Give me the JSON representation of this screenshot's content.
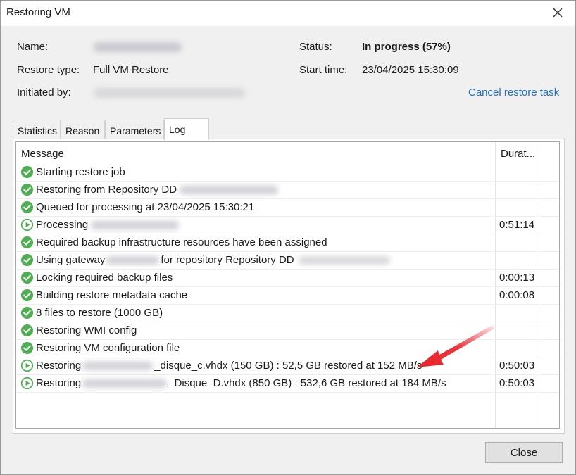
{
  "window": {
    "title": "Restoring VM"
  },
  "summary": {
    "name_label": "Name:",
    "restore_type_label": "Restore type:",
    "restore_type_value": "Full VM Restore",
    "initiated_by_label": "Initiated by:",
    "status_label": "Status:",
    "status_value": "In progress (57%)",
    "start_time_label": "Start time:",
    "start_time_value": "23/04/2025 15:30:09",
    "cancel_link": "Cancel restore task"
  },
  "tabs": [
    {
      "label": "Statistics"
    },
    {
      "label": "Reason"
    },
    {
      "label": "Parameters"
    },
    {
      "label": "Log",
      "active": true
    }
  ],
  "log": {
    "columns": {
      "message": "Message",
      "duration": "Durat..."
    },
    "rows": [
      {
        "status": "success",
        "text": "Starting restore job",
        "duration": ""
      },
      {
        "status": "success",
        "text": "Restoring from Repository DD",
        "duration": ""
      },
      {
        "status": "success",
        "text": "Queued for processing at 23/04/2025 15:30:21",
        "duration": ""
      },
      {
        "status": "running",
        "text": "Processing",
        "duration": "0:51:14"
      },
      {
        "status": "success",
        "text": "Required backup infrastructure resources have been assigned",
        "duration": ""
      },
      {
        "status": "success",
        "text_before": "Using gateway",
        "text_after": "for repository Repository DD",
        "duration": ""
      },
      {
        "status": "success",
        "text": "Locking required backup files",
        "duration": "0:00:13"
      },
      {
        "status": "success",
        "text": "Building restore metadata cache",
        "duration": "0:00:08"
      },
      {
        "status": "success",
        "text": "8 files to restore (1000 GB)",
        "duration": ""
      },
      {
        "status": "success",
        "text": "Restoring WMI config",
        "duration": ""
      },
      {
        "status": "success",
        "text": "Restoring VM configuration file",
        "duration": ""
      },
      {
        "status": "running",
        "text_before": "Restoring",
        "text_after": "_disque_c.vhdx (150 GB) : 52,5 GB restored at 152 MB/s",
        "duration": "0:50:03"
      },
      {
        "status": "running",
        "text_before": "Restoring",
        "text_after": "_Disque_D.vhdx (850 GB) : 532,6 GB restored at 184 MB/s",
        "duration": "0:50:03"
      }
    ]
  },
  "footer": {
    "close_label": "Close"
  },
  "colors": {
    "success_green": "#4caf50",
    "link_blue": "#1f6fbf",
    "arrow_red": "#e8202a"
  },
  "icons": {
    "success": "check-circle-icon",
    "running": "play-circle-icon",
    "close": "close-icon"
  }
}
